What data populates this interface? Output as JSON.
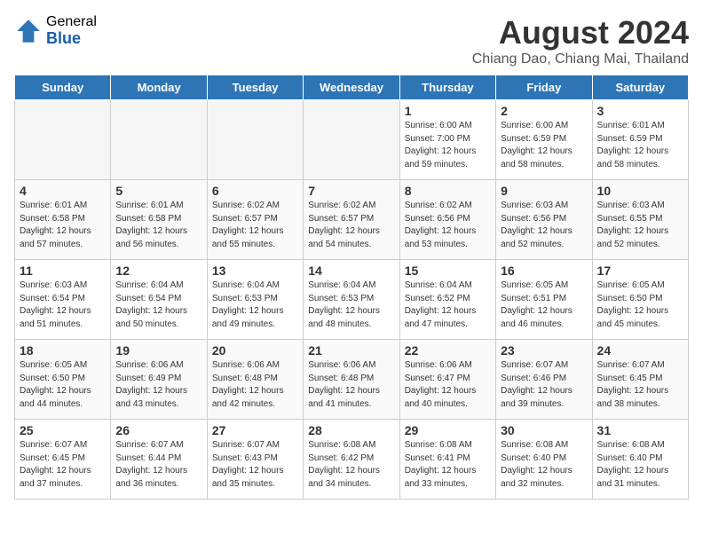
{
  "header": {
    "logo_general": "General",
    "logo_blue": "Blue",
    "month": "August 2024",
    "location": "Chiang Dao, Chiang Mai, Thailand"
  },
  "days_of_week": [
    "Sunday",
    "Monday",
    "Tuesday",
    "Wednesday",
    "Thursday",
    "Friday",
    "Saturday"
  ],
  "weeks": [
    [
      {
        "date": "",
        "sunrise": "",
        "sunset": "",
        "daylight": ""
      },
      {
        "date": "",
        "sunrise": "",
        "sunset": "",
        "daylight": ""
      },
      {
        "date": "",
        "sunrise": "",
        "sunset": "",
        "daylight": ""
      },
      {
        "date": "",
        "sunrise": "",
        "sunset": "",
        "daylight": ""
      },
      {
        "date": "1",
        "sunrise": "Sunrise: 6:00 AM",
        "sunset": "Sunset: 7:00 PM",
        "daylight": "Daylight: 12 hours and 59 minutes."
      },
      {
        "date": "2",
        "sunrise": "Sunrise: 6:00 AM",
        "sunset": "Sunset: 6:59 PM",
        "daylight": "Daylight: 12 hours and 58 minutes."
      },
      {
        "date": "3",
        "sunrise": "Sunrise: 6:01 AM",
        "sunset": "Sunset: 6:59 PM",
        "daylight": "Daylight: 12 hours and 58 minutes."
      }
    ],
    [
      {
        "date": "4",
        "sunrise": "Sunrise: 6:01 AM",
        "sunset": "Sunset: 6:58 PM",
        "daylight": "Daylight: 12 hours and 57 minutes."
      },
      {
        "date": "5",
        "sunrise": "Sunrise: 6:01 AM",
        "sunset": "Sunset: 6:58 PM",
        "daylight": "Daylight: 12 hours and 56 minutes."
      },
      {
        "date": "6",
        "sunrise": "Sunrise: 6:02 AM",
        "sunset": "Sunset: 6:57 PM",
        "daylight": "Daylight: 12 hours and 55 minutes."
      },
      {
        "date": "7",
        "sunrise": "Sunrise: 6:02 AM",
        "sunset": "Sunset: 6:57 PM",
        "daylight": "Daylight: 12 hours and 54 minutes."
      },
      {
        "date": "8",
        "sunrise": "Sunrise: 6:02 AM",
        "sunset": "Sunset: 6:56 PM",
        "daylight": "Daylight: 12 hours and 53 minutes."
      },
      {
        "date": "9",
        "sunrise": "Sunrise: 6:03 AM",
        "sunset": "Sunset: 6:56 PM",
        "daylight": "Daylight: 12 hours and 52 minutes."
      },
      {
        "date": "10",
        "sunrise": "Sunrise: 6:03 AM",
        "sunset": "Sunset: 6:55 PM",
        "daylight": "Daylight: 12 hours and 52 minutes."
      }
    ],
    [
      {
        "date": "11",
        "sunrise": "Sunrise: 6:03 AM",
        "sunset": "Sunset: 6:54 PM",
        "daylight": "Daylight: 12 hours and 51 minutes."
      },
      {
        "date": "12",
        "sunrise": "Sunrise: 6:04 AM",
        "sunset": "Sunset: 6:54 PM",
        "daylight": "Daylight: 12 hours and 50 minutes."
      },
      {
        "date": "13",
        "sunrise": "Sunrise: 6:04 AM",
        "sunset": "Sunset: 6:53 PM",
        "daylight": "Daylight: 12 hours and 49 minutes."
      },
      {
        "date": "14",
        "sunrise": "Sunrise: 6:04 AM",
        "sunset": "Sunset: 6:53 PM",
        "daylight": "Daylight: 12 hours and 48 minutes."
      },
      {
        "date": "15",
        "sunrise": "Sunrise: 6:04 AM",
        "sunset": "Sunset: 6:52 PM",
        "daylight": "Daylight: 12 hours and 47 minutes."
      },
      {
        "date": "16",
        "sunrise": "Sunrise: 6:05 AM",
        "sunset": "Sunset: 6:51 PM",
        "daylight": "Daylight: 12 hours and 46 minutes."
      },
      {
        "date": "17",
        "sunrise": "Sunrise: 6:05 AM",
        "sunset": "Sunset: 6:50 PM",
        "daylight": "Daylight: 12 hours and 45 minutes."
      }
    ],
    [
      {
        "date": "18",
        "sunrise": "Sunrise: 6:05 AM",
        "sunset": "Sunset: 6:50 PM",
        "daylight": "Daylight: 12 hours and 44 minutes."
      },
      {
        "date": "19",
        "sunrise": "Sunrise: 6:06 AM",
        "sunset": "Sunset: 6:49 PM",
        "daylight": "Daylight: 12 hours and 43 minutes."
      },
      {
        "date": "20",
        "sunrise": "Sunrise: 6:06 AM",
        "sunset": "Sunset: 6:48 PM",
        "daylight": "Daylight: 12 hours and 42 minutes."
      },
      {
        "date": "21",
        "sunrise": "Sunrise: 6:06 AM",
        "sunset": "Sunset: 6:48 PM",
        "daylight": "Daylight: 12 hours and 41 minutes."
      },
      {
        "date": "22",
        "sunrise": "Sunrise: 6:06 AM",
        "sunset": "Sunset: 6:47 PM",
        "daylight": "Daylight: 12 hours and 40 minutes."
      },
      {
        "date": "23",
        "sunrise": "Sunrise: 6:07 AM",
        "sunset": "Sunset: 6:46 PM",
        "daylight": "Daylight: 12 hours and 39 minutes."
      },
      {
        "date": "24",
        "sunrise": "Sunrise: 6:07 AM",
        "sunset": "Sunset: 6:45 PM",
        "daylight": "Daylight: 12 hours and 38 minutes."
      }
    ],
    [
      {
        "date": "25",
        "sunrise": "Sunrise: 6:07 AM",
        "sunset": "Sunset: 6:45 PM",
        "daylight": "Daylight: 12 hours and 37 minutes."
      },
      {
        "date": "26",
        "sunrise": "Sunrise: 6:07 AM",
        "sunset": "Sunset: 6:44 PM",
        "daylight": "Daylight: 12 hours and 36 minutes."
      },
      {
        "date": "27",
        "sunrise": "Sunrise: 6:07 AM",
        "sunset": "Sunset: 6:43 PM",
        "daylight": "Daylight: 12 hours and 35 minutes."
      },
      {
        "date": "28",
        "sunrise": "Sunrise: 6:08 AM",
        "sunset": "Sunset: 6:42 PM",
        "daylight": "Daylight: 12 hours and 34 minutes."
      },
      {
        "date": "29",
        "sunrise": "Sunrise: 6:08 AM",
        "sunset": "Sunset: 6:41 PM",
        "daylight": "Daylight: 12 hours and 33 minutes."
      },
      {
        "date": "30",
        "sunrise": "Sunrise: 6:08 AM",
        "sunset": "Sunset: 6:40 PM",
        "daylight": "Daylight: 12 hours and 32 minutes."
      },
      {
        "date": "31",
        "sunrise": "Sunrise: 6:08 AM",
        "sunset": "Sunset: 6:40 PM",
        "daylight": "Daylight: 12 hours and 31 minutes."
      }
    ]
  ]
}
